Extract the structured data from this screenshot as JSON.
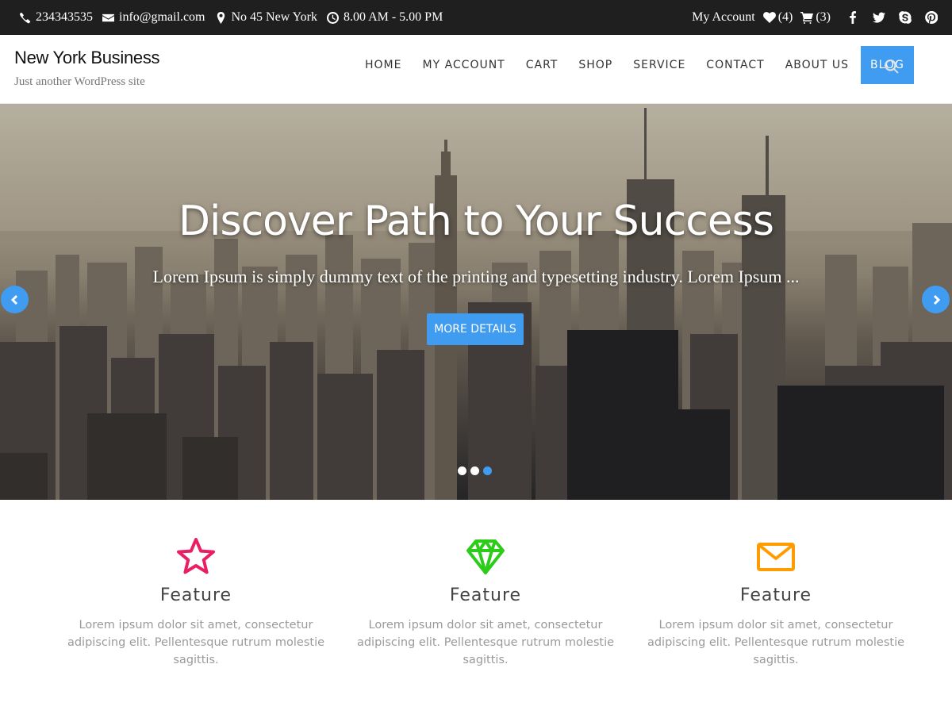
{
  "topbar": {
    "phone": "234343535",
    "email": "info@gmail.com",
    "address": "No 45 New York",
    "hours": "8.00 AM - 5.00 PM",
    "account_label": "My Account",
    "wishlist_count": "(4)",
    "cart_count": "(3)",
    "social": [
      "facebook-icon",
      "twitter-icon",
      "skype-icon",
      "pinterest-icon"
    ]
  },
  "header": {
    "site_title": "New York Business",
    "tagline": "Just another WordPress site",
    "nav": [
      "HOME",
      "MY ACCOUNT",
      "CART",
      "SHOP",
      "SERVICE",
      "CONTACT",
      "ABOUT US",
      "BLOG"
    ],
    "active_nav": "BLOG"
  },
  "hero": {
    "title": "Discover Path to Your Success",
    "subtitle": "Lorem Ipsum is simply dummy text of the printing and typesetting industry. Lorem Ipsum ...",
    "button_label": "MORE DETAILS",
    "slides_total": 3,
    "active_slide": 3
  },
  "features": [
    {
      "icon": "star-icon",
      "title": "Feature",
      "text": "Lorem ipsum dolor sit amet, consectetur adipiscing elit. Pellentesque rutrum molestie sagittis.",
      "color": "#e91e63"
    },
    {
      "icon": "diamond-icon",
      "title": "Feature",
      "text": "Lorem ipsum dolor sit amet, consectetur adipiscing elit. Pellentesque rutrum molestie sagittis.",
      "color": "#2ecc1a"
    },
    {
      "icon": "envelope-icon",
      "title": "Feature",
      "text": "Lorem ipsum dolor sit amet, consectetur adipiscing elit. Pellentesque rutrum molestie sagittis.",
      "color": "#ff9d00"
    }
  ],
  "colors": {
    "accent": "#3f9cf0",
    "topbar_bg": "#1f1f1f"
  }
}
